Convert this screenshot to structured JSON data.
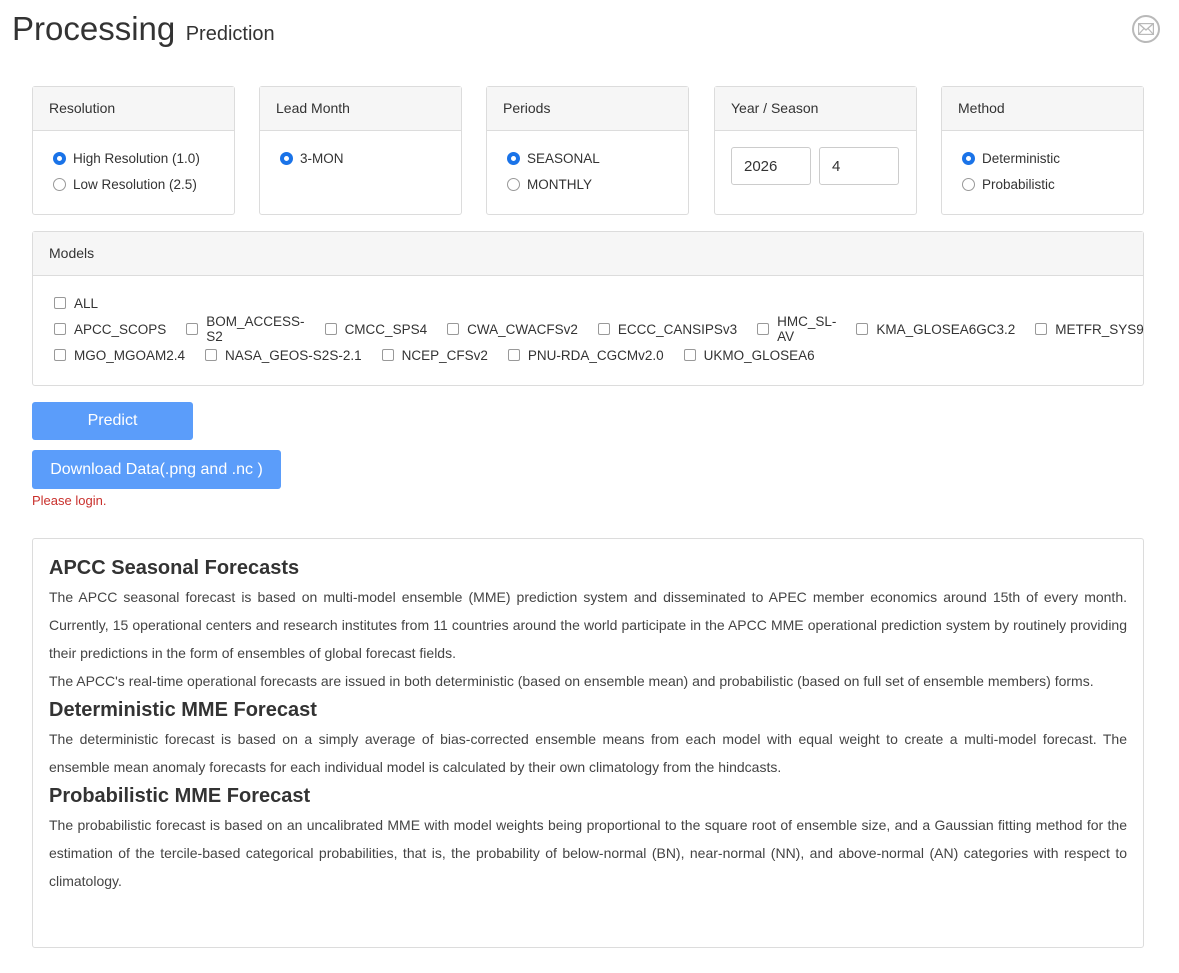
{
  "header": {
    "title": "Processing",
    "subtitle": "Prediction",
    "mail_icon": "mail-icon"
  },
  "resolution": {
    "label": "Resolution",
    "options": [
      {
        "label": "High Resolution (1.0)",
        "selected": true
      },
      {
        "label": "Low Resolution (2.5)",
        "selected": false
      }
    ]
  },
  "lead_month": {
    "label": "Lead Month",
    "options": [
      {
        "label": "3-MON",
        "selected": true
      }
    ]
  },
  "periods": {
    "label": "Periods",
    "options": [
      {
        "label": "SEASONAL",
        "selected": true
      },
      {
        "label": "MONTHLY",
        "selected": false
      }
    ]
  },
  "year_season": {
    "label": "Year / Season",
    "year": "2026",
    "season": "4"
  },
  "method": {
    "label": "Method",
    "options": [
      {
        "label": "Deterministic",
        "selected": true
      },
      {
        "label": "Probabilistic",
        "selected": false
      }
    ]
  },
  "models": {
    "label": "Models",
    "all_label": "ALL",
    "row1": [
      "APCC_SCOPS",
      "BOM_ACCESS-S2",
      "CMCC_SPS4",
      "CWA_CWACFSv2",
      "ECCC_CANSIPSv3",
      "HMC_SL-AV",
      "KMA_GLOSEA6GC3.2",
      "METFR_SYS9"
    ],
    "row2": [
      "MGO_MGOAM2.4",
      "NASA_GEOS-S2S-2.1",
      "NCEP_CFSv2",
      "PNU-RDA_CGCMv2.0",
      "UKMO_GLOSEA6"
    ]
  },
  "buttons": {
    "predict": "Predict",
    "download": "Download Data(.png and .nc )"
  },
  "login_message": "Please login.",
  "info": {
    "h1": "APCC Seasonal Forecasts",
    "p1": "The APCC seasonal forecast is based on multi-model ensemble (MME) prediction system and disseminated to APEC member economics around 15th of every month. Currently, 15 operational centers and research institutes from 11 countries around the world participate in the APCC MME operational prediction system by routinely providing their predictions in the form of ensembles of global forecast fields.",
    "p2": "The APCC's real-time operational forecasts are issued in both deterministic (based on ensemble mean) and probabilistic (based on full set of ensemble members) forms.",
    "h2": "Deterministic MME Forecast",
    "p3": "The deterministic forecast is based on a simply average of bias-corrected ensemble means from each model with equal weight to create a multi-model forecast. The ensemble mean anomaly forecasts for each individual model is calculated by their own climatology from the hindcasts.",
    "h3": "Probabilistic MME Forecast",
    "p4": "The probabilistic forecast is based on an uncalibrated MME with model weights being proportional to the square root of ensemble size, and a Gaussian fitting method for the estimation of the tercile-based categorical probabilities, that is, the probability of below-normal (BN), near-normal (NN), and above-normal (AN) categories with respect to climatology."
  }
}
